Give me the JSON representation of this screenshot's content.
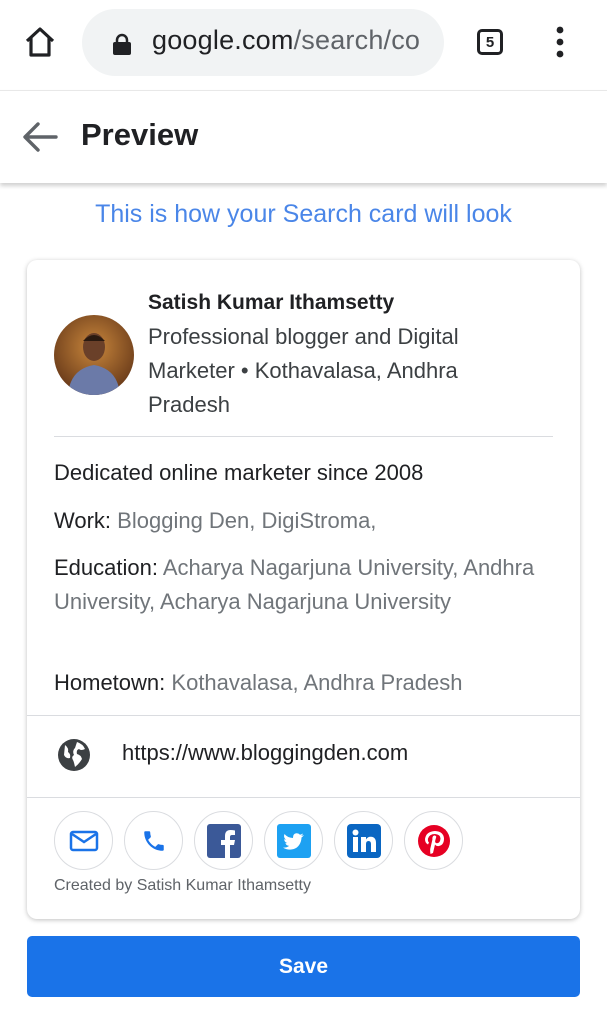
{
  "browser": {
    "url_host": "google.com",
    "url_path": "/search/co",
    "tab_count": "5"
  },
  "appbar": {
    "title": "Preview"
  },
  "subtitle": "This is how your Search card will look",
  "card": {
    "name": "Satish Kumar Ithamsetty",
    "description": "Professional blogger and Digital Marketer • Kothavalasa, Andhra Pradesh",
    "tagline": "Dedicated online marketer since 2008",
    "work_label": "Work:",
    "work_value": "Blogging Den, DigiStroma,",
    "education_label": "Education:",
    "education_value": "Acharya Nagarjuna University, Andhra University, Acharya Nagarjuna University",
    "hometown_label": "Hometown:",
    "hometown_value": "Kothavalasa, Andhra Pradesh",
    "website": "https://www.bloggingden.com",
    "contacts": [
      "mail-icon",
      "phone-icon",
      "facebook-icon",
      "twitter-icon",
      "linkedin-icon",
      "pinterest-icon"
    ],
    "created_by": "Created by Satish Kumar Ithamsetty"
  },
  "save_label": "Save",
  "colors": {
    "accent": "#1a73e8",
    "subtitle": "#4a86e8",
    "facebook": "#3b5998",
    "twitter": "#1da1f2",
    "linkedin": "#0a66c2",
    "pinterest": "#e60023"
  }
}
